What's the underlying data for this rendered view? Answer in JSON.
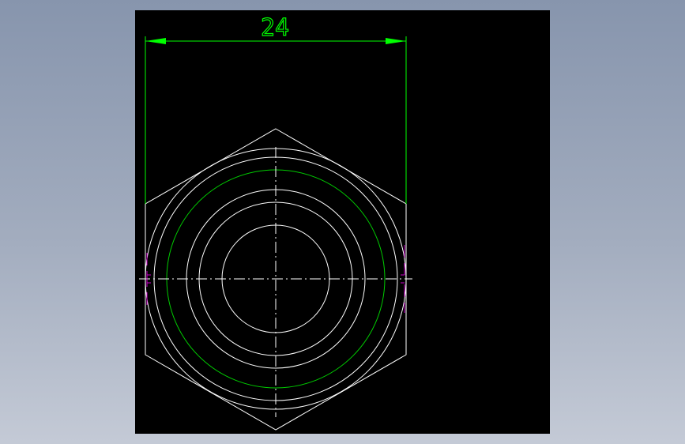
{
  "drawing": {
    "dimension": {
      "value_text": "24"
    },
    "colors": {
      "background": "#000000",
      "geometry": "#ffffff",
      "dimension": "#00ff00",
      "thread_circle": "#00cc00",
      "marker": "#cc00cc"
    },
    "icons": {
      "arrow": "arrowhead-icon"
    }
  }
}
